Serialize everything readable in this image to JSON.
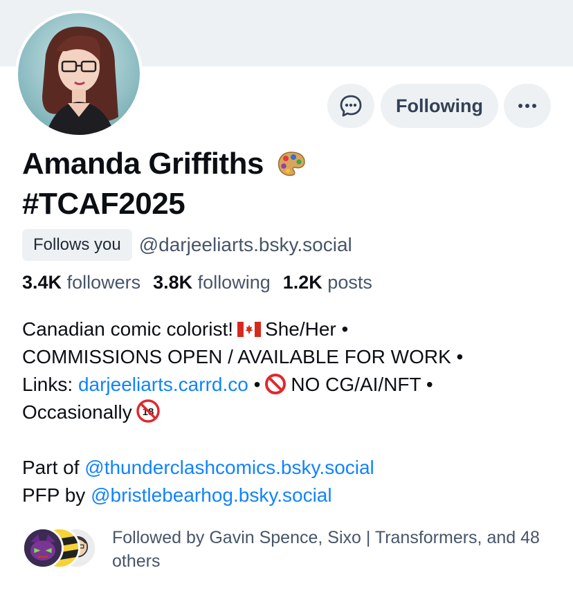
{
  "profile": {
    "display_name": "Amanda Griffiths",
    "display_name_emoji": "artist-palette",
    "display_name_line2": "#TCAF2025",
    "follows_you_badge": "Follows you",
    "handle": "@darjeeliarts.bsky.social"
  },
  "actions": {
    "chat_icon": "chat-bubble-icon",
    "follow_label": "Following",
    "more_icon": "ellipsis-icon"
  },
  "stats": {
    "followers_count": "3.4K",
    "followers_label": "followers",
    "following_count": "3.8K",
    "following_label": "following",
    "posts_count": "1.2K",
    "posts_label": "posts"
  },
  "bio": {
    "line1_text": "Canadian comic colorist!",
    "line1_flag": "canada-flag",
    "line1_after": "She/Her •",
    "line2": "COMMISSIONS OPEN / AVAILABLE FOR WORK •",
    "line3_prefix": "Links:",
    "line3_link": "darjeeliarts.carrd.co",
    "line3_sep": "•",
    "line3_prohibited_icon": "no-entry-icon",
    "line3_after": "NO CG/AI/NFT •",
    "line4_text": "Occasionally",
    "line4_icon": "no-one-under-18-icon",
    "part_of_prefix": "Part of",
    "part_of_link": "@thunderclashcomics.bsky.social",
    "pfp_prefix": "PFP by",
    "pfp_link": "@bristlebearhog.bsky.social"
  },
  "followed_by": {
    "text": "Followed by Gavin Spence, Sixo | Transformers, and 48 others"
  },
  "colors": {
    "link": "#1083fe",
    "muted": "#475569",
    "button_bg": "#eef1f4",
    "banner": "#eef1f4"
  }
}
